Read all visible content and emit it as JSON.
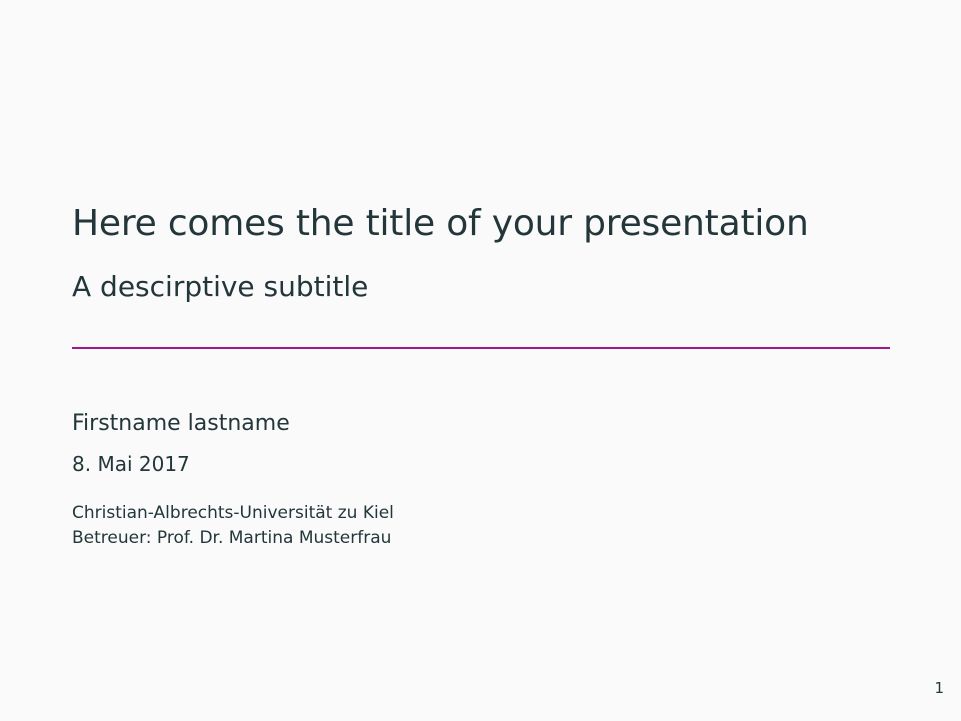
{
  "slide": {
    "title": "Here comes the title of your presentation",
    "subtitle": "A descirptive subtitle",
    "author": "Firstname lastname",
    "date": "8. Mai 2017",
    "institute_line1": "Christian-Albrechts-Universität zu Kiel",
    "institute_line2": "Betreuer: Prof. Dr. Martina Musterfrau",
    "page_number": "1"
  },
  "colors": {
    "background": "#fafafa",
    "text": "#23373b",
    "accent_rule": "#a0178d"
  }
}
